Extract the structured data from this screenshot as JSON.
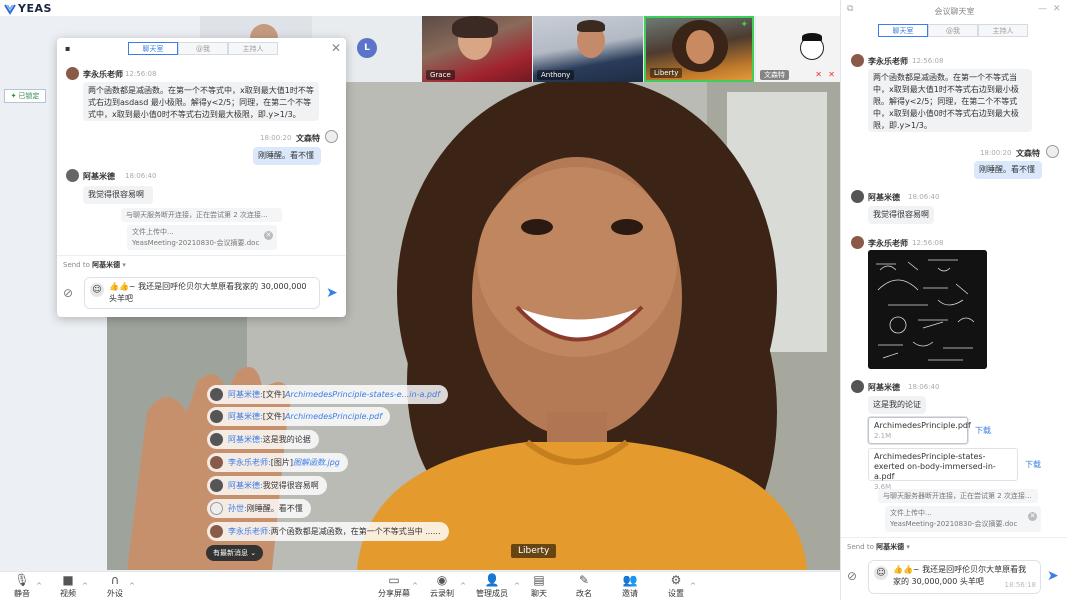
{
  "app": {
    "logo_text": "YEAS"
  },
  "locked_label": "已锁定",
  "avatar_letter": "L",
  "participants": [
    {
      "name": "Grace"
    },
    {
      "name": "Anthony"
    },
    {
      "name": "Liberty"
    },
    {
      "name": "文森特"
    }
  ],
  "main_speaker": "Liberty",
  "popup": {
    "tabs": [
      "聊天室",
      "@我",
      "主持人"
    ],
    "messages": [
      {
        "name": "李永乐老师",
        "time": "12:56:08",
        "text": "两个函数都是减函数。在第一个不等式中，x取到最大值1时不等式右边到asdasd 最小极限。解得y<2/5；同理，在第二个不等式中，x取到最小值0时不等式右边到最大极限，即.y>1/3。"
      },
      {
        "name": "文森特",
        "time": "18:00:20",
        "text": "刚睡醒。看不懂"
      },
      {
        "name": "阿基米德",
        "time": "18:06:40",
        "text": "我觉得很容易啊"
      }
    ],
    "system_notice": "与聊天服务断开连接，正在尝试第 2 次连接...",
    "uploading_label": "文件上传中...",
    "uploading_file": "YeasMeeting-20210830-会议摘要.doc",
    "send_to_label": "Send to",
    "send_to_target": "阿基米德",
    "input_text": "👍👍~ 我还是回呼伦贝尔大草原看我家的 30,000,000 头羊吧"
  },
  "overlay": [
    {
      "who": "阿基米德:",
      "tag": "[文件]",
      "link": "ArchimedesPrinciple-states-e...in-a.pdf"
    },
    {
      "who": "阿基米德:",
      "tag": "[文件]",
      "link": "ArchimedesPrinciple.pdf"
    },
    {
      "who": "阿基米德:",
      "text": "这是我的论据"
    },
    {
      "who": "李永乐老师:",
      "tag": "[图片]",
      "link": "图解函数.jpg"
    },
    {
      "who": "阿基米德:",
      "text": "我觉得很容易啊"
    },
    {
      "who": "孙世:",
      "text": "刚睡醒。看不懂"
    },
    {
      "who": "李永乐老师:",
      "text": "两个函数都是减函数，在第一个不等式当中 ......"
    }
  ],
  "new_msg_label": "有最新消息",
  "side": {
    "title": "会议聊天室",
    "tabs": [
      "聊天室",
      "@我",
      "主持人"
    ],
    "msg1": {
      "name": "李永乐老师",
      "time": "12:56:08",
      "text": "两个函数都是减函数。在第一个不等式当中，x取到最大值1时不等式右边到最小极限。解得y<2/5；同理，在第二个不等式中，x取到最小值0时不等式右边到最大极限，即.y>1/3。"
    },
    "msg2": {
      "name": "文森特",
      "time": "18:00:20",
      "text": "刚睡醒。看不懂"
    },
    "msg3": {
      "name": "阿基米德",
      "time": "18:06:40",
      "text": "我觉得很容易啊"
    },
    "msg4": {
      "name": "李永乐老师",
      "time": "12:56:08"
    },
    "msg5": {
      "name": "阿基米德",
      "time": "18:06:40",
      "text": "这是我的论证"
    },
    "file1": {
      "name": "ArchimedesPrinciple.pdf",
      "size": "2.1M"
    },
    "file2": {
      "name": "ArchimedesPrinciple-states-exerted on-body-immersed-in-a.pdf",
      "size": "3.6M"
    },
    "download_label": "下载",
    "system_notice": "与聊天服务器断开连接，正在尝试第 2 次连接...",
    "uploading_label": "文件上传中...",
    "uploading_file": "YeasMeeting-20210830-会议摘要.doc",
    "send_to_label": "Send to",
    "send_to_target": "阿基米德",
    "input_text": "👍👍~ 我还是回呼伦贝尔大草原看我家的 30,000,000 头羊吧",
    "input_time": "18:56:18"
  },
  "toolbar": {
    "mute": "静音",
    "video": "视频",
    "speaker": "外设",
    "share": "分享屏幕",
    "record": "云录制",
    "manage": "管理成员",
    "chat": "聊天",
    "rename": "改名",
    "invite": "邀请",
    "settings": "设置"
  }
}
